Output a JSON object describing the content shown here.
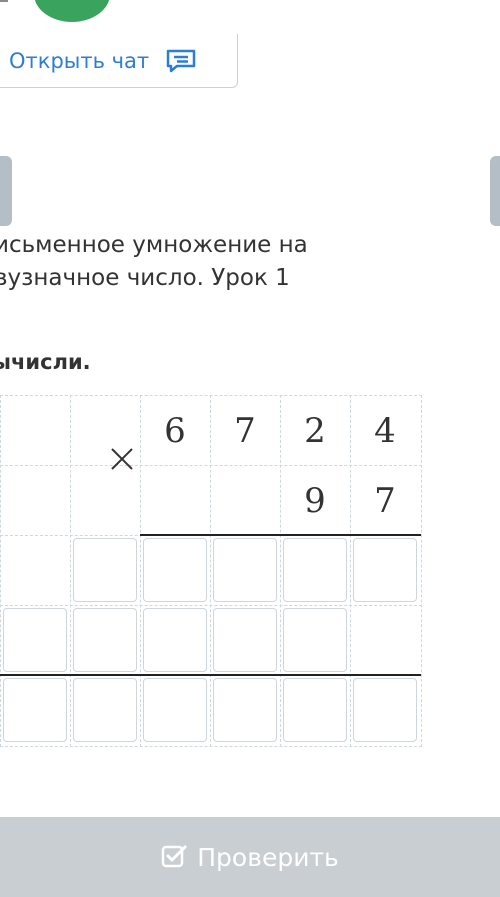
{
  "header": {
    "chat_button_label": "Открыть чат"
  },
  "lesson": {
    "title": "исьменное умножение на вузначное число. Урок 1",
    "task": "ычисли."
  },
  "problem": {
    "multiplicand_digits": [
      "6",
      "7",
      "2",
      "4"
    ],
    "multiplier_digits": [
      "9",
      "7"
    ],
    "operator": "×"
  },
  "footer": {
    "check_button_label": "Проверить"
  },
  "colors": {
    "accent": "#2c7dd6",
    "avatar": "#3aa45f",
    "check_bar": "#c9ced3"
  }
}
